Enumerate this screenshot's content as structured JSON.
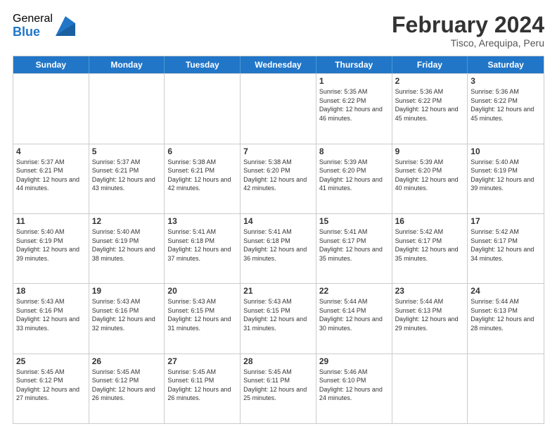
{
  "logo": {
    "general": "General",
    "blue": "Blue"
  },
  "header": {
    "title": "February 2024",
    "subtitle": "Tisco, Arequipa, Peru"
  },
  "weekdays": [
    "Sunday",
    "Monday",
    "Tuesday",
    "Wednesday",
    "Thursday",
    "Friday",
    "Saturday"
  ],
  "weeks": [
    [
      {
        "day": "",
        "info": ""
      },
      {
        "day": "",
        "info": ""
      },
      {
        "day": "",
        "info": ""
      },
      {
        "day": "",
        "info": ""
      },
      {
        "day": "1",
        "info": "Sunrise: 5:35 AM\nSunset: 6:22 PM\nDaylight: 12 hours and 46 minutes."
      },
      {
        "day": "2",
        "info": "Sunrise: 5:36 AM\nSunset: 6:22 PM\nDaylight: 12 hours and 45 minutes."
      },
      {
        "day": "3",
        "info": "Sunrise: 5:36 AM\nSunset: 6:22 PM\nDaylight: 12 hours and 45 minutes."
      }
    ],
    [
      {
        "day": "4",
        "info": "Sunrise: 5:37 AM\nSunset: 6:21 PM\nDaylight: 12 hours and 44 minutes."
      },
      {
        "day": "5",
        "info": "Sunrise: 5:37 AM\nSunset: 6:21 PM\nDaylight: 12 hours and 43 minutes."
      },
      {
        "day": "6",
        "info": "Sunrise: 5:38 AM\nSunset: 6:21 PM\nDaylight: 12 hours and 42 minutes."
      },
      {
        "day": "7",
        "info": "Sunrise: 5:38 AM\nSunset: 6:20 PM\nDaylight: 12 hours and 42 minutes."
      },
      {
        "day": "8",
        "info": "Sunrise: 5:39 AM\nSunset: 6:20 PM\nDaylight: 12 hours and 41 minutes."
      },
      {
        "day": "9",
        "info": "Sunrise: 5:39 AM\nSunset: 6:20 PM\nDaylight: 12 hours and 40 minutes."
      },
      {
        "day": "10",
        "info": "Sunrise: 5:40 AM\nSunset: 6:19 PM\nDaylight: 12 hours and 39 minutes."
      }
    ],
    [
      {
        "day": "11",
        "info": "Sunrise: 5:40 AM\nSunset: 6:19 PM\nDaylight: 12 hours and 39 minutes."
      },
      {
        "day": "12",
        "info": "Sunrise: 5:40 AM\nSunset: 6:19 PM\nDaylight: 12 hours and 38 minutes."
      },
      {
        "day": "13",
        "info": "Sunrise: 5:41 AM\nSunset: 6:18 PM\nDaylight: 12 hours and 37 minutes."
      },
      {
        "day": "14",
        "info": "Sunrise: 5:41 AM\nSunset: 6:18 PM\nDaylight: 12 hours and 36 minutes."
      },
      {
        "day": "15",
        "info": "Sunrise: 5:41 AM\nSunset: 6:17 PM\nDaylight: 12 hours and 35 minutes."
      },
      {
        "day": "16",
        "info": "Sunrise: 5:42 AM\nSunset: 6:17 PM\nDaylight: 12 hours and 35 minutes."
      },
      {
        "day": "17",
        "info": "Sunrise: 5:42 AM\nSunset: 6:17 PM\nDaylight: 12 hours and 34 minutes."
      }
    ],
    [
      {
        "day": "18",
        "info": "Sunrise: 5:43 AM\nSunset: 6:16 PM\nDaylight: 12 hours and 33 minutes."
      },
      {
        "day": "19",
        "info": "Sunrise: 5:43 AM\nSunset: 6:16 PM\nDaylight: 12 hours and 32 minutes."
      },
      {
        "day": "20",
        "info": "Sunrise: 5:43 AM\nSunset: 6:15 PM\nDaylight: 12 hours and 31 minutes."
      },
      {
        "day": "21",
        "info": "Sunrise: 5:43 AM\nSunset: 6:15 PM\nDaylight: 12 hours and 31 minutes."
      },
      {
        "day": "22",
        "info": "Sunrise: 5:44 AM\nSunset: 6:14 PM\nDaylight: 12 hours and 30 minutes."
      },
      {
        "day": "23",
        "info": "Sunrise: 5:44 AM\nSunset: 6:13 PM\nDaylight: 12 hours and 29 minutes."
      },
      {
        "day": "24",
        "info": "Sunrise: 5:44 AM\nSunset: 6:13 PM\nDaylight: 12 hours and 28 minutes."
      }
    ],
    [
      {
        "day": "25",
        "info": "Sunrise: 5:45 AM\nSunset: 6:12 PM\nDaylight: 12 hours and 27 minutes."
      },
      {
        "day": "26",
        "info": "Sunrise: 5:45 AM\nSunset: 6:12 PM\nDaylight: 12 hours and 26 minutes."
      },
      {
        "day": "27",
        "info": "Sunrise: 5:45 AM\nSunset: 6:11 PM\nDaylight: 12 hours and 26 minutes."
      },
      {
        "day": "28",
        "info": "Sunrise: 5:45 AM\nSunset: 6:11 PM\nDaylight: 12 hours and 25 minutes."
      },
      {
        "day": "29",
        "info": "Sunrise: 5:46 AM\nSunset: 6:10 PM\nDaylight: 12 hours and 24 minutes."
      },
      {
        "day": "",
        "info": ""
      },
      {
        "day": "",
        "info": ""
      }
    ]
  ]
}
